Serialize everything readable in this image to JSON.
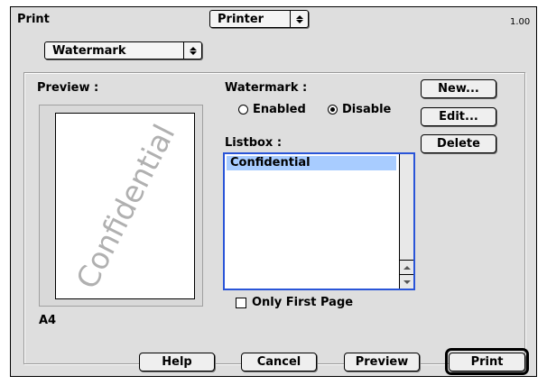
{
  "header": {
    "title": "Print",
    "panel_select": "Printer",
    "version": "1.00"
  },
  "panel_popup": {
    "value": "Watermark"
  },
  "preview": {
    "label": "Preview :",
    "watermark_text": "Confidential",
    "paper_size": "A4"
  },
  "watermark": {
    "label": "Watermark :",
    "enabled_label": "Enabled",
    "disable_label": "Disable",
    "selected": "Disable"
  },
  "listbox": {
    "label": "Listbox :",
    "items": [
      "Confidential"
    ],
    "selected_index": 0
  },
  "only_first_page": {
    "label": "Only First Page",
    "checked": false
  },
  "side_buttons": {
    "new": "New...",
    "edit": "Edit...",
    "delete": "Delete"
  },
  "footer_buttons": {
    "help": "Help",
    "cancel": "Cancel",
    "preview": "Preview",
    "print": "Print"
  }
}
